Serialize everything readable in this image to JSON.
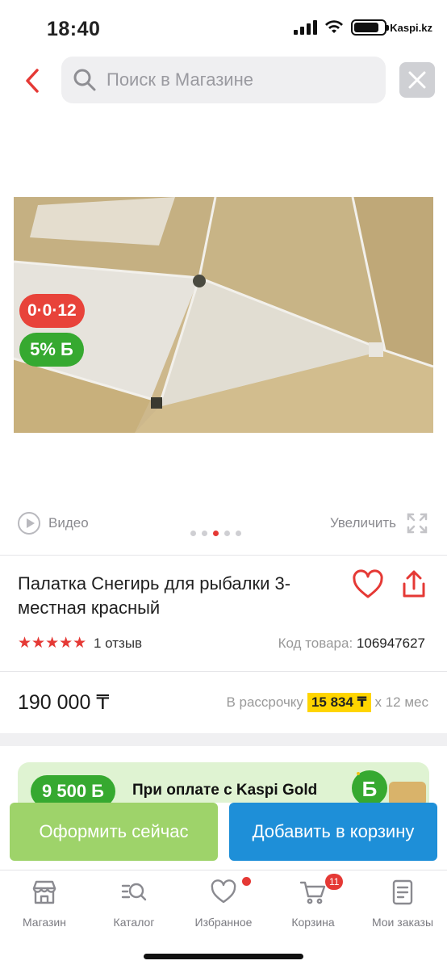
{
  "status_bar": {
    "time": "18:40",
    "carrier": "Kaspi.kz"
  },
  "search": {
    "placeholder": "Поиск в Магазине"
  },
  "icons": {
    "back": "chevron-left-icon",
    "search": "search-icon",
    "close": "close-icon",
    "favorite": "heart-icon",
    "share": "share-icon",
    "play": "play-icon",
    "expand": "expand-icon"
  },
  "badges": {
    "timer": "0·0·12",
    "bonus": "5% Б"
  },
  "gallery": {
    "video_label": "Видео",
    "zoom_label": "Увеличить",
    "slides": 5,
    "active_slide": 3
  },
  "product": {
    "title": "Палатка Снегирь для рыбалки 3-местная красный",
    "rating": 5,
    "stars": "★★★★★",
    "reviews": "1 отзыв",
    "sku_label": "Код товара:",
    "sku": "106947627",
    "price": "190 000 ₸",
    "installment_prefix": "В рассрочку",
    "installment_amount": "15 834 ₸",
    "installment_suffix": "х 12 мес"
  },
  "promo": {
    "bonus": "9 500 Б",
    "text": "При оплате с Kaspi Gold"
  },
  "actions": {
    "buy_now": "Оформить сейчас",
    "add_to_cart": "Добавить в корзину"
  },
  "tabbar": [
    {
      "label": "Магазин",
      "icon": "store-icon"
    },
    {
      "label": "Каталог",
      "icon": "catalog-search-icon"
    },
    {
      "label": "Избранное",
      "icon": "heart-icon"
    },
    {
      "label": "Корзина",
      "icon": "cart-icon",
      "badge": "11"
    },
    {
      "label": "Мои заказы",
      "icon": "orders-icon"
    }
  ],
  "colors": {
    "accent_red": "#e53935",
    "green": "#36a930",
    "light_green": "#9ed36a",
    "blue": "#1e8fd8",
    "yellow": "#ffd500"
  }
}
